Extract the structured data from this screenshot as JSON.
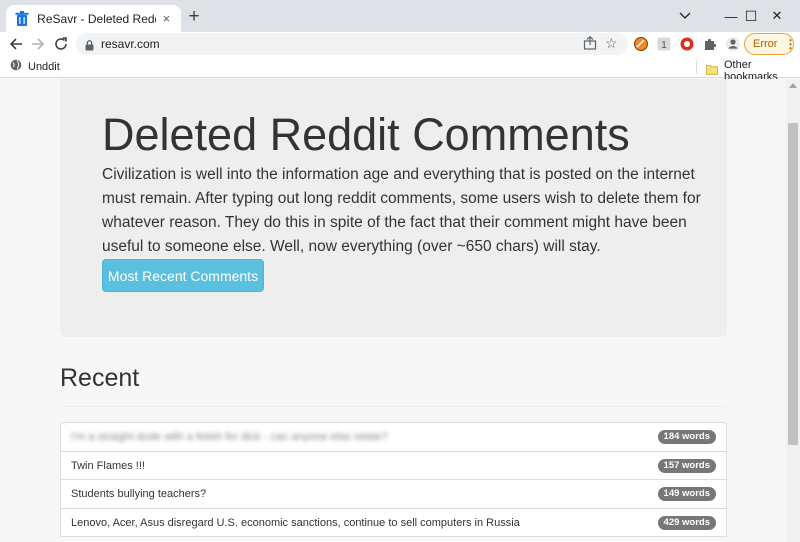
{
  "browser": {
    "tab_title": "ReSavr - Deleted Reddit Comme",
    "tab_close": "×",
    "new_tab": "+",
    "url": "resavr.com",
    "error_label": "Error",
    "window_controls": {
      "minimize": "—",
      "maximize": "☐",
      "close": "✕"
    }
  },
  "bookmarks": {
    "items": [
      {
        "label": "Unddit"
      }
    ],
    "other": "Other bookmarks"
  },
  "hero": {
    "title": "Deleted Reddit Comments",
    "lead": "Civilization is well into the information age and everything that is posted on the internet must remain. After typing out long reddit comments, some users wish to delete them for whatever reason. They do this in spite of the fact that their comment might have been useful to someone else. Well, now everything (over ~650 chars) will stay.",
    "button": "Most Recent Comments"
  },
  "recent": {
    "heading": "Recent",
    "items": [
      {
        "title": "I'm a straight dude with a fetish for dick - can anyone else relate?",
        "words": "184 words",
        "blurred": true
      },
      {
        "title": "Twin Flames !!!",
        "words": "157 words",
        "blurred": false
      },
      {
        "title": "Students bullying teachers?",
        "words": "149 words",
        "blurred": false
      },
      {
        "title": "Lenovo, Acer, Asus disregard U.S. economic sanctions, continue to sell computers in Russia",
        "words": "429 words",
        "blurred": false
      }
    ]
  },
  "colors": {
    "accent": "#5bc0de",
    "badge": "#777777",
    "jumbotron": "#eeeeee",
    "error": "#b06000"
  },
  "icons": [
    "trash-icon",
    "back-icon",
    "forward-icon",
    "reload-icon",
    "lock-icon",
    "share-icon",
    "star-icon",
    "puzzle-icon",
    "profile-icon",
    "globe-icon",
    "folder-icon"
  ]
}
